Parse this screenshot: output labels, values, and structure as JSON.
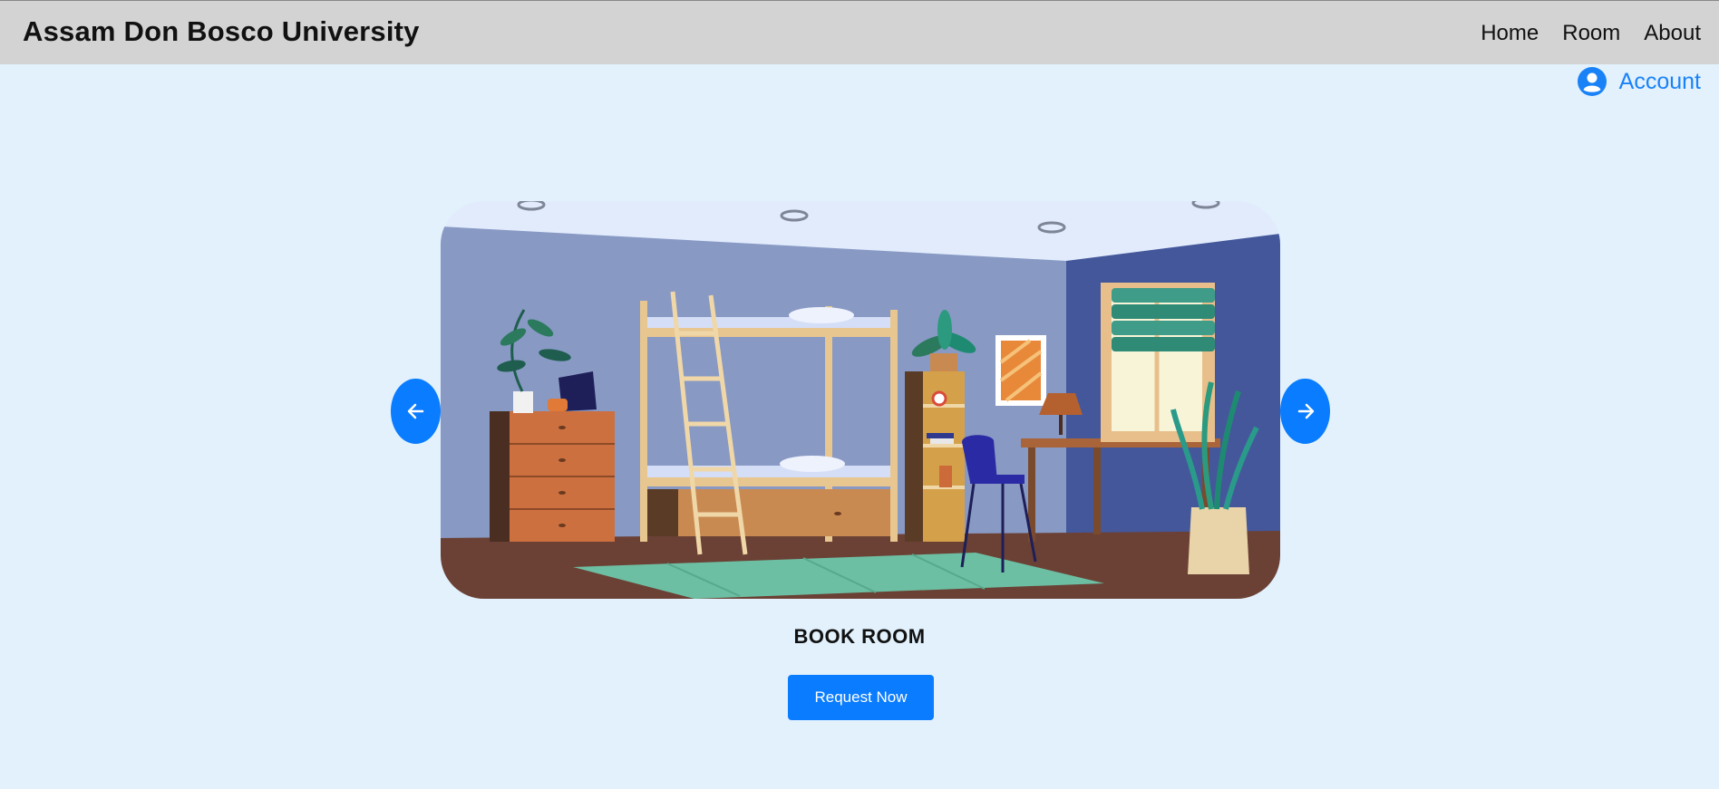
{
  "navbar": {
    "brand": "Assam Don Bosco University",
    "links": [
      {
        "label": "Home"
      },
      {
        "label": "Room"
      },
      {
        "label": "About"
      }
    ]
  },
  "account": {
    "label": "Account",
    "icon": "user-circle-icon"
  },
  "carousel": {
    "slide_image": "dorm-room-illustration",
    "prev_icon": "arrow-left-icon",
    "next_icon": "arrow-right-icon"
  },
  "booking": {
    "title": "BOOK ROOM",
    "button_label": "Request Now"
  },
  "colors": {
    "background": "#e2f1fc",
    "navbar": "#d3d3d3",
    "accent": "#0a7cff"
  }
}
